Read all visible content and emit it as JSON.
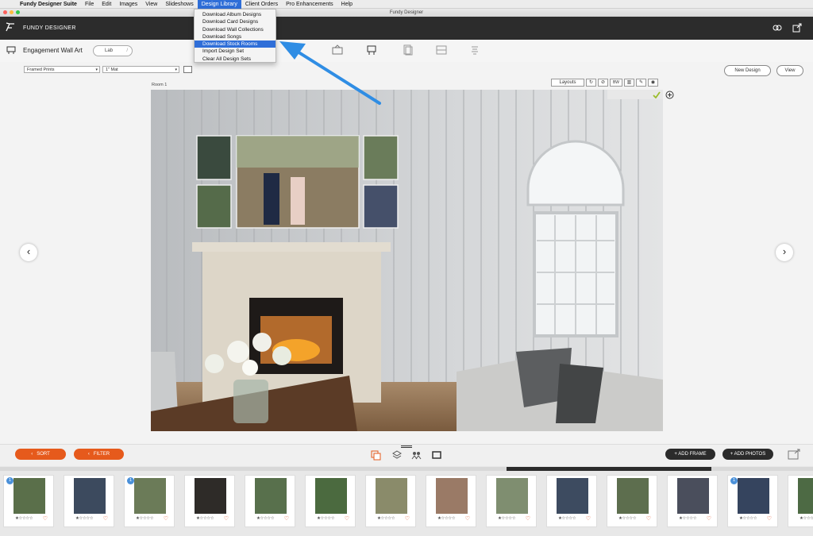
{
  "menubar": {
    "app_name": "Fundy Designer Suite",
    "items": [
      "File",
      "Edit",
      "Images",
      "View",
      "Slideshows",
      "Design Library",
      "Client Orders",
      "Pro Enhancements",
      "Help"
    ]
  },
  "window_title": "Fundy Designer",
  "brand": "FUNDY DESIGNER",
  "dropdown_menu": {
    "items": [
      "Download Album Designs",
      "Download Card Designs",
      "Download Wall Collections",
      "Download Songs",
      "Download Stock Rooms",
      "Import Design Set",
      "Clear All Design Sets"
    ],
    "highlighted": "Download Stock Rooms"
  },
  "design_title": "Engagement Wall Art",
  "lab_label": "Lab",
  "frame_select": "Framed Prints",
  "mat_select": "1\" Mat",
  "new_design_label": "New Design",
  "view_label": "View",
  "room_label": "Room 1",
  "room_tools": {
    "layouts_label": "Layouts",
    "bw_label": "BW"
  },
  "bottom": {
    "sort_label": "SORT",
    "filter_label": "FILTER",
    "add_frame_label": "+ ADD FRAME",
    "add_photos_label": "+ ADD PHOTOS"
  },
  "timeline_position": 0.62,
  "thumbnails": [
    {
      "badge": "1",
      "stars": "★☆☆☆☆"
    },
    {
      "badge": "",
      "stars": "★☆☆☆☆"
    },
    {
      "badge": "1",
      "stars": "★☆☆☆☆"
    },
    {
      "badge": "",
      "stars": "★☆☆☆☆"
    },
    {
      "badge": "",
      "stars": "★☆☆☆☆"
    },
    {
      "badge": "",
      "stars": "★☆☆☆☆"
    },
    {
      "badge": "",
      "stars": "★☆☆☆☆"
    },
    {
      "badge": "",
      "stars": "★☆☆☆☆"
    },
    {
      "badge": "",
      "stars": "★☆☆☆☆"
    },
    {
      "badge": "",
      "stars": "★☆☆☆☆"
    },
    {
      "badge": "",
      "stars": "★☆☆☆☆"
    },
    {
      "badge": "",
      "stars": "★☆☆☆☆"
    },
    {
      "badge": "1",
      "stars": "★☆☆☆☆"
    },
    {
      "badge": "",
      "stars": "★☆☆☆☆"
    }
  ],
  "colors": {
    "accent": "#e65a1c",
    "menu_highlight": "#2f6ed8",
    "header": "#2c2c2c",
    "arrow": "#2f8de4"
  }
}
